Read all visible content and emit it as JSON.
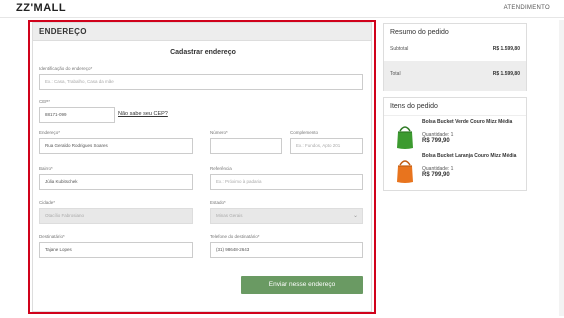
{
  "header": {
    "logo": "ZZ'MALL",
    "help_link": "ATENDIMENTO"
  },
  "address_card": {
    "heading": "ENDEREÇO",
    "form_title": "Cadastrar endereço",
    "fields": {
      "identification": {
        "label": "Identificação do endereço*",
        "placeholder": "Ex.: Casa, Trabalho, Casa da mãe"
      },
      "cep": {
        "label": "CEP*",
        "value": "88171-099"
      },
      "cep_help": "Não sabe seu CEP?",
      "street": {
        "label": "Endereço*",
        "value": "Rua Geraldo Rodrigues Soares"
      },
      "number": {
        "label": "Número*",
        "value": ""
      },
      "complement": {
        "label": "Complemento",
        "placeholder": "Ex.: Fundos, Apto 201"
      },
      "district": {
        "label": "Bairro*",
        "value": "Júlia Kubitschek"
      },
      "reference": {
        "label": "Referência",
        "placeholder": "Ex.: Próximo à padaria"
      },
      "city": {
        "label": "Cidade*",
        "value": "Otacílio Fabrosiano"
      },
      "state": {
        "label": "Estado*",
        "value": "Minas Gerais"
      },
      "recipient": {
        "label": "Destinatário*",
        "value": "Tajane Lopes"
      },
      "recipient_phone": {
        "label": "Telefone do destinatário*",
        "value": "(31) 98648-2643"
      }
    },
    "submit_label": "Enviar nesse endereço"
  },
  "summary": {
    "title": "Resumo do pedido",
    "subtotal_label": "Subtotal",
    "subtotal_value": "R$ 1.599,80",
    "total_label": "Total",
    "total_value": "R$ 1.599,80"
  },
  "items": {
    "title": "Itens do pedido",
    "list": [
      {
        "name": "Bolsa Bucket Verde Couro Mizz Média",
        "qty": "Quantidade: 1",
        "price": "R$ 799,90",
        "color": "#3c9a2f",
        "icon": "green-bag-icon"
      },
      {
        "name": "Bolsa Bucket Laranja Couro Mizz Média",
        "qty": "Quantidade: 1",
        "price": "R$ 799,90",
        "color": "#e8741e",
        "icon": "orange-bag-icon"
      }
    ]
  },
  "colors": {
    "highlight_frame": "#d0021b",
    "submit_button": "#6a9a63"
  }
}
